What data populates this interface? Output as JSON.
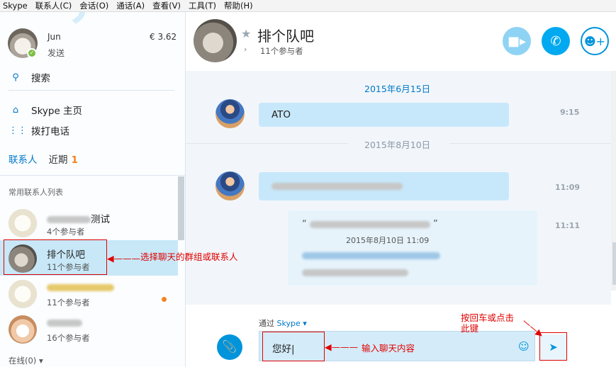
{
  "menubar": [
    "Skype",
    "联系人(C)",
    "会话(O)",
    "通话(A)",
    "查看(V)",
    "工具(T)",
    "帮助(H)"
  ],
  "profile": {
    "name": "Jun",
    "status": "发送",
    "credit": "€ 3.62"
  },
  "sidebar": {
    "search_label": "搜索",
    "home_label": "Skype 主页",
    "dial_label": "拨打电话",
    "tab_contacts": "联系人",
    "tab_recent": "近期",
    "recent_badge": "1",
    "list_header": "常用联系人列表",
    "footer": "在线(0)",
    "contacts": [
      {
        "name_suffix": "测试",
        "sub": "4个参与者"
      },
      {
        "name": "排个队吧",
        "sub": "11个参与者"
      },
      {
        "name": "",
        "sub": "11个参与者"
      },
      {
        "name": "",
        "sub": "16个参与者"
      }
    ]
  },
  "chat": {
    "title": "排个队吧",
    "members": "11个参与者",
    "date1": "2015年6月15日",
    "date2": "2015年8月10日",
    "msg1_text": "ATO",
    "msg1_time": "9:15",
    "msg2_time": "11:09",
    "quote_time_label": "2015年8月10日 11:09",
    "quote_time": "11:11",
    "via_prefix": "通过",
    "via_service": "Skype",
    "input_text": "您好"
  },
  "annotations": {
    "select": "选择聊天的群组或联系人",
    "input": "输入聊天内容",
    "send": "按回车或点击\n此键"
  }
}
